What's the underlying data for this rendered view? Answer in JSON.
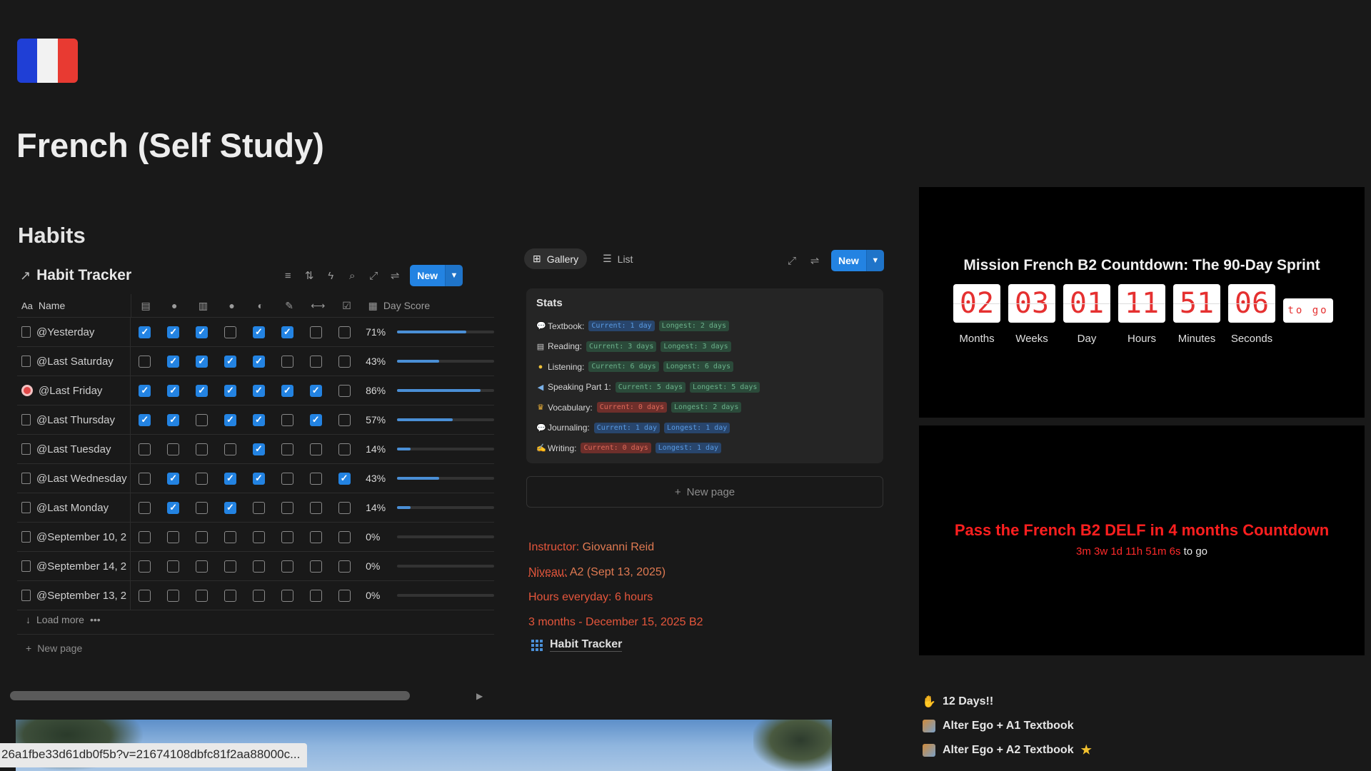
{
  "page": {
    "title": "French (Self Study)",
    "section": "Habits"
  },
  "flag": {
    "colors": [
      "#1f3fd6",
      "#f2f2f2",
      "#e83a32"
    ]
  },
  "habit_tracker": {
    "title": "Habit Tracker",
    "new_label": "New",
    "columns": {
      "name": "Name",
      "score": "Day Score"
    },
    "habit_icons": [
      "book-icon",
      "bulb-icon",
      "open-book-icon",
      "speaker-icon",
      "ear-icon",
      "pen-icon",
      "dumbbell-icon",
      "edit-icon"
    ],
    "rows": [
      {
        "name": "@Yesterday",
        "checks": [
          1,
          1,
          1,
          0,
          1,
          1,
          0,
          0
        ],
        "score": "71%",
        "fill": 0.71
      },
      {
        "name": "@Last Saturday",
        "checks": [
          0,
          1,
          1,
          1,
          1,
          0,
          0,
          0
        ],
        "score": "43%",
        "fill": 0.43
      },
      {
        "name": "@Last Friday",
        "checks": [
          1,
          1,
          1,
          1,
          1,
          1,
          1,
          0
        ],
        "score": "86%",
        "fill": 0.86
      },
      {
        "name": "@Last Thursday",
        "checks": [
          1,
          1,
          0,
          1,
          1,
          0,
          1,
          0
        ],
        "score": "57%",
        "fill": 0.57
      },
      {
        "name": "@Last Tuesday",
        "checks": [
          0,
          0,
          0,
          0,
          1,
          0,
          0,
          0
        ],
        "score": "14%",
        "fill": 0.14
      },
      {
        "name": "@Last Wednesday",
        "checks": [
          0,
          1,
          0,
          1,
          1,
          0,
          0,
          1
        ],
        "score": "43%",
        "fill": 0.43
      },
      {
        "name": "@Last Monday",
        "checks": [
          0,
          1,
          0,
          1,
          0,
          0,
          0,
          0
        ],
        "score": "14%",
        "fill": 0.14
      },
      {
        "name": "@September 10, 2",
        "checks": [
          0,
          0,
          0,
          0,
          0,
          0,
          0,
          0
        ],
        "score": "0%",
        "fill": 0
      },
      {
        "name": "@September 14, 2",
        "checks": [
          0,
          0,
          0,
          0,
          0,
          0,
          0,
          0
        ],
        "score": "0%",
        "fill": 0
      },
      {
        "name": "@September 13, 2",
        "checks": [
          0,
          0,
          0,
          0,
          0,
          0,
          0,
          0
        ],
        "score": "0%",
        "fill": 0
      }
    ],
    "load_more": "Load more",
    "new_page": "New page"
  },
  "gallery": {
    "tabs": [
      {
        "label": "Gallery"
      },
      {
        "label": "List"
      }
    ],
    "new_label": "New",
    "stats_title": "Stats",
    "stats": [
      {
        "label": "Textbook:",
        "current": "Current: 1 day",
        "current_color": "blue",
        "longest": "Longest: 2 days",
        "longest_color": "green"
      },
      {
        "label": "Reading:",
        "current": "Current: 3 days",
        "current_color": "green",
        "longest": "Longest: 3 days",
        "longest_color": "green"
      },
      {
        "label": "Listening:",
        "current": "Current: 6 days",
        "current_color": "green",
        "longest": "Longest: 6 days",
        "longest_color": "green"
      },
      {
        "label": "Speaking Part 1:",
        "current": "Current: 5 days",
        "current_color": "green",
        "longest": "Longest: 5 days",
        "longest_color": "green"
      },
      {
        "label": "Vocabulary:",
        "current": "Current: 0 days",
        "current_color": "red",
        "longest": "Longest: 2 days",
        "longest_color": "green"
      },
      {
        "label": "Journaling:",
        "current": "Current: 1 day",
        "current_color": "blue",
        "longest": "Longest: 1 day",
        "longest_color": "blue"
      },
      {
        "label": "Writing:",
        "current": "Current: 0 days",
        "current_color": "red",
        "longest": "Longest: 1 day",
        "longest_color": "blue"
      }
    ],
    "new_page": "New page"
  },
  "info": {
    "instructor_label": "Instructor:",
    "instructor": "Giovanni Reid",
    "niveau_label": "Niveau:",
    "niveau": "A2 (Sept 13, 2025)",
    "hours": "Hours everyday: 6 hours",
    "timeline": "3 months - December 15, 2025 B2",
    "link": "Habit Tracker"
  },
  "countdown1": {
    "title": "Mission French B2 Countdown: The 90-Day Sprint",
    "units": [
      {
        "value": "02",
        "label": "Months"
      },
      {
        "value": "03",
        "label": "Weeks"
      },
      {
        "value": "01",
        "label": "Day"
      },
      {
        "value": "11",
        "label": "Hours"
      },
      {
        "value": "51",
        "label": "Minutes"
      },
      {
        "value": "06",
        "label": "Seconds"
      }
    ],
    "togo": "to go"
  },
  "countdown2": {
    "title": "Pass the French B2 DELF in 4 months Countdown",
    "remaining": "3m 3w 1d 11h 51m 6s",
    "suffix": "to go"
  },
  "side_list": [
    {
      "label": "12 Days!!"
    },
    {
      "label": "Alter Ego + A1 Textbook"
    },
    {
      "label": "Alter Ego + A2 Textbook"
    }
  ],
  "status_url": "26a1fbe33d61db0f5b?v=21674108dbfc81f2aa88000c..."
}
